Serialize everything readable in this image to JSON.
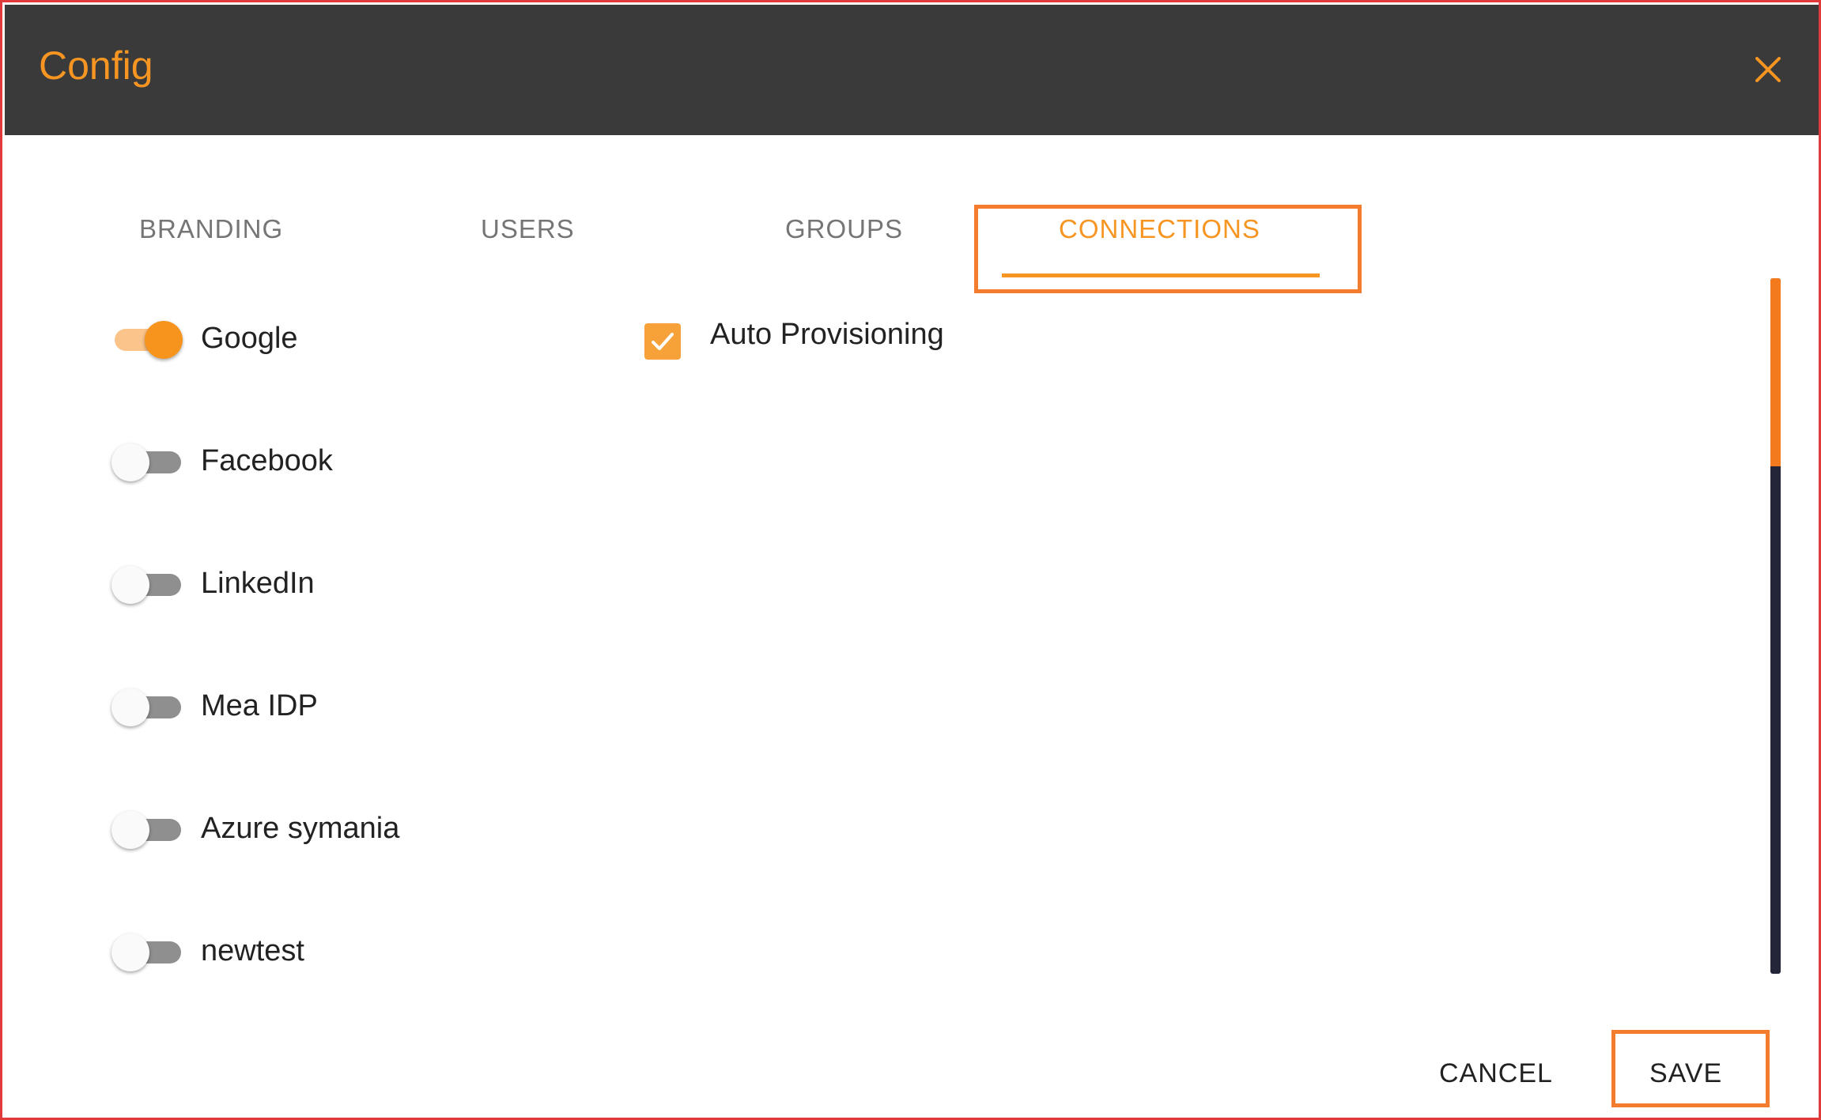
{
  "dialog": {
    "title": "Config",
    "close_icon": "close-icon",
    "colors": {
      "header_bg": "#3a3a3a",
      "accent": "#f79522",
      "highlight_border": "#f47c2e",
      "window_border": "#e03a3a"
    }
  },
  "tabs": [
    {
      "label": "BRANDING",
      "active": false
    },
    {
      "label": "USERS",
      "active": false
    },
    {
      "label": "GROUPS",
      "active": false
    },
    {
      "label": "CONNECTIONS",
      "active": true
    }
  ],
  "connections": [
    {
      "label": "Google",
      "enabled": true
    },
    {
      "label": "Facebook",
      "enabled": false
    },
    {
      "label": "LinkedIn",
      "enabled": false
    },
    {
      "label": "Mea IDP",
      "enabled": false
    },
    {
      "label": "Azure symania",
      "enabled": false
    },
    {
      "label": "newtest",
      "enabled": false
    }
  ],
  "auto_provisioning": {
    "label": "Auto Provisioning",
    "checked": true
  },
  "footer": {
    "cancel_label": "CANCEL",
    "save_label": "SAVE"
  }
}
